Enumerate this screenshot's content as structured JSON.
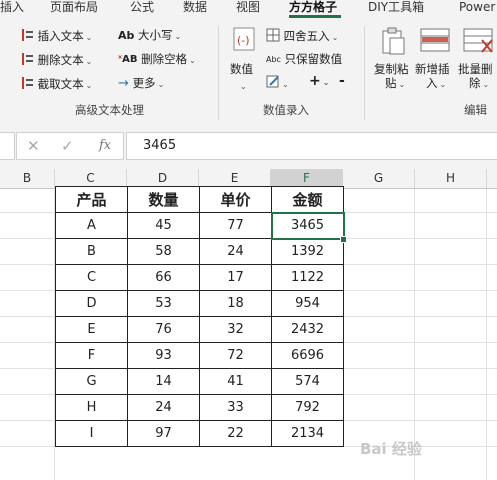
{
  "tabs": [
    {
      "label": "插入"
    },
    {
      "label": "页面布局"
    },
    {
      "label": "公式"
    },
    {
      "label": "数据"
    },
    {
      "label": "视图"
    },
    {
      "label": "方方格子"
    },
    {
      "label": "DIY工具箱"
    },
    {
      "label": "Power"
    }
  ],
  "ribbon": {
    "text_group": {
      "insert_text": "插入文本",
      "delete_text": "删除文本",
      "extract_text": "截取文本",
      "case": "大小写",
      "delete_space": "删除空格",
      "more": "更多",
      "label": "高级文本处理"
    },
    "number_group": {
      "number": "数值",
      "round": "四舍五入",
      "keep_number": "只保留数值",
      "label": "数值录入",
      "plus": "+",
      "minus": "-"
    },
    "edit_group": {
      "copy_paste": "复制粘",
      "copy_paste_2": "贴",
      "add_insert": "新增插",
      "add_insert_2": "入",
      "batch_delete": "批量删",
      "batch_delete_2": "除",
      "label": "编辑"
    }
  },
  "formula_bar": {
    "cancel": "✕",
    "confirm": "✓",
    "fx": "fx",
    "value": "3465"
  },
  "columns": [
    "B",
    "C",
    "D",
    "E",
    "F",
    "G",
    "H"
  ],
  "table": {
    "headers": [
      "产品",
      "数量",
      "单价",
      "金额"
    ],
    "rows": [
      [
        "A",
        "45",
        "77",
        "3465"
      ],
      [
        "B",
        "58",
        "24",
        "1392"
      ],
      [
        "C",
        "66",
        "17",
        "1122"
      ],
      [
        "D",
        "53",
        "18",
        "954"
      ],
      [
        "E",
        "76",
        "32",
        "2432"
      ],
      [
        "F",
        "93",
        "72",
        "6696"
      ],
      [
        "G",
        "14",
        "41",
        "574"
      ],
      [
        "H",
        "24",
        "33",
        "792"
      ],
      [
        "I",
        "97",
        "22",
        "2134"
      ]
    ]
  },
  "watermark": "Bai 经验",
  "colors": {
    "accent": "#217346"
  }
}
